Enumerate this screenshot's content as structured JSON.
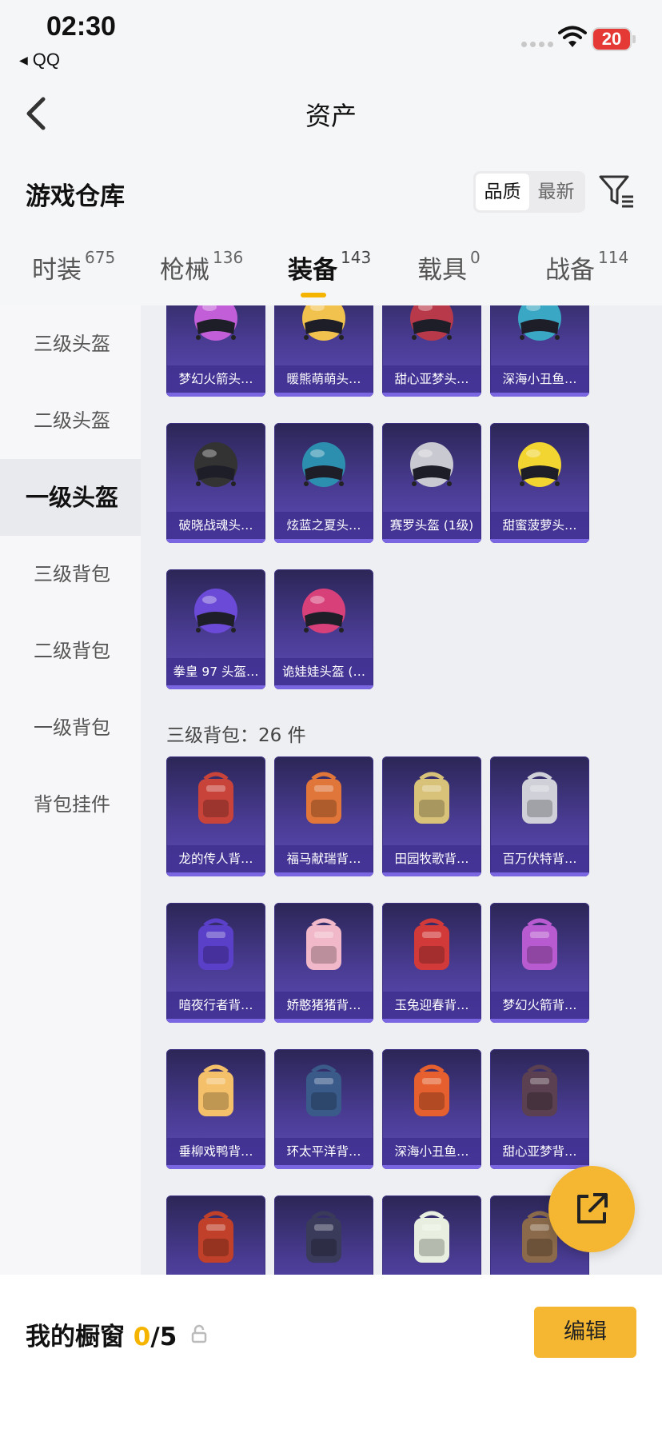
{
  "status_bar": {
    "time": "02:30",
    "back_app": "QQ",
    "battery": "20"
  },
  "nav": {
    "title": "资产"
  },
  "warehouse": {
    "title": "游戏仓库",
    "sort": [
      "品质",
      "最新"
    ]
  },
  "tabs": [
    {
      "label": "时装",
      "count": "675"
    },
    {
      "label": "枪械",
      "count": "136"
    },
    {
      "label": "装备",
      "count": "143"
    },
    {
      "label": "载具",
      "count": "0"
    },
    {
      "label": "战备",
      "count": "114"
    }
  ],
  "sidebar": [
    "三级头盔",
    "二级头盔",
    "一级头盔",
    "三级背包",
    "二级背包",
    "一级背包",
    "背包挂件"
  ],
  "helmets": [
    "梦幻火箭头…",
    "暖熊萌萌头…",
    "甜心亚梦头…",
    "深海小丑鱼…",
    "破晓战魂头…",
    "炫蓝之夏头…",
    "赛罗头盔 (1级)",
    "甜蜜菠萝头…",
    "拳皇 97 头盔…",
    "诡娃娃头盔 (…"
  ],
  "backpack_group": "三级背包：26 件",
  "backpacks": [
    "龙的传人背…",
    "福马献瑞背…",
    "田园牧歌背…",
    "百万伏特背…",
    "暗夜行者背…",
    "娇憨猪猪背…",
    "玉兔迎春背…",
    "梦幻火箭背…",
    "垂柳戏鸭背…",
    "环太平洋背…",
    "深海小丑鱼…",
    "甜心亚梦背…",
    "",
    "",
    "",
    ""
  ],
  "colors": {
    "helmet": [
      "#c25fd8",
      "#f1c24e",
      "#b83a4a",
      "#3aa7c4",
      "#333333",
      "#2d8fb0",
      "#c9c9d2",
      "#f2d531",
      "#6a4ad6",
      "#d8407a"
    ],
    "backpack": [
      "#c8443a",
      "#e0763a",
      "#d8c27a",
      "#cfd0d8",
      "#5a3fc8",
      "#f0b8c8",
      "#d23a3a",
      "#b85ad0",
      "#f5c06a",
      "#3a5a8a",
      "#e5602e",
      "#5a4050",
      "#c0402a",
      "#3a3a5a",
      "#e8efe0",
      "#8a6a4a"
    ]
  },
  "showcase": {
    "label": "我的橱窗",
    "count": "0",
    "total": "/5"
  },
  "edit_label": "编辑"
}
